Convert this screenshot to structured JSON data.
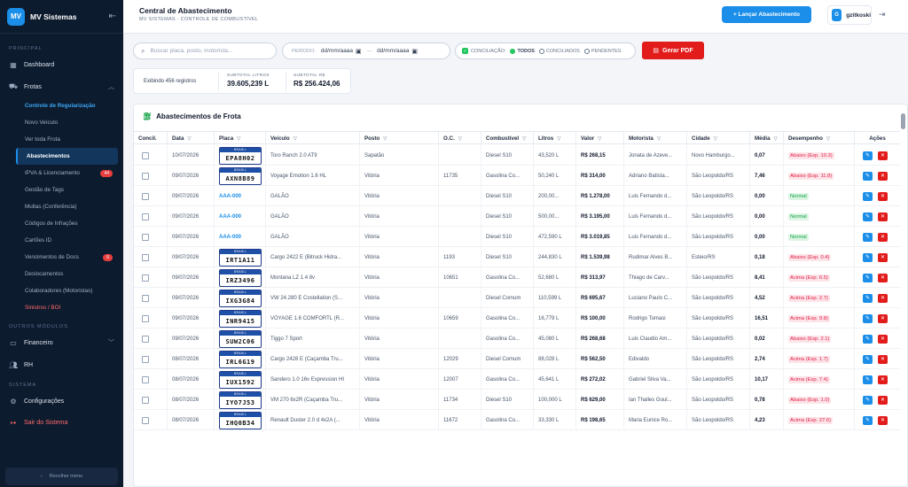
{
  "sidebar": {
    "logo": "MV",
    "brand": "MV Sistemas",
    "sec_principal": "PRINCIPAL",
    "dashboard": "Dashboard",
    "frotas": "Frotas",
    "subitems": [
      {
        "label": "Controle de Regularização",
        "badge": ""
      },
      {
        "label": "Novo Veículo",
        "badge": ""
      },
      {
        "label": "Ver toda Frota",
        "badge": ""
      },
      {
        "label": "Abastecimentos",
        "badge": ""
      },
      {
        "label": "IPVA & Licenciamento",
        "badge": "44"
      },
      {
        "label": "Gestão de Tags",
        "badge": ""
      },
      {
        "label": "Multas (Conferência)",
        "badge": ""
      },
      {
        "label": "Códigos de Infrações",
        "badge": ""
      },
      {
        "label": "Cartões ID",
        "badge": ""
      },
      {
        "label": "Vencimentos de Docs",
        "badge": "6"
      },
      {
        "label": "Deslocamentos",
        "badge": ""
      },
      {
        "label": "Colaboradores (Motoristas)",
        "badge": ""
      },
      {
        "label": "Sinistros / BOI",
        "badge": ""
      }
    ],
    "sec_outros": "OUTROS MÓDULOS",
    "financeiro": "Financeiro",
    "rh": "RH",
    "sec_sistema": "SISTEMA",
    "config": "Configurações",
    "logout": "Sair do Sistema",
    "recolher": "Recolher menu"
  },
  "topbar": {
    "title": "Central de Abastecimento",
    "subtitle": "MV SISTEMAS - CONTROLE DE COMBUSTÍVEL",
    "launch": "+ Lançar Abastecimento",
    "avatar": "G",
    "user": "gzitkoski"
  },
  "filters": {
    "search_placeholder": "Buscar placa, posto, motorista...",
    "period_label": "PERÍODO:",
    "date_start": "dd/mm/aaaa",
    "date_end": "dd/mm/aaaa",
    "date_sep": "—",
    "concil_label": "CONCILIAÇÃO:",
    "opt_todos": "TODOS",
    "opt_conciliados": "CONCILIADOS",
    "opt_pendentes": "PENDENTES",
    "pdf": "Gerar PDF"
  },
  "stats": {
    "info": "Exibindo 456 registros",
    "litros_label": "SUBTOTAL LITROS",
    "litros_value": "39.605,239 L",
    "rs_label": "SUBTOTAL R$",
    "rs_value": "R$ 256.424,06"
  },
  "table": {
    "title": "Abastecimentos de Frota",
    "headers": [
      "Concil.",
      "Data",
      "Placa",
      "Veículo",
      "Posto",
      "O.C.",
      "Combustível",
      "Litros",
      "Valor",
      "Motorista",
      "Cidade",
      "Média",
      "Desempenho",
      "Ações"
    ],
    "plate_country": "BRASIL",
    "rows": [
      {
        "data": "10/07/2026",
        "placa": "EPA8H02",
        "placa_tipo": "plate",
        "veiculo": "Toro Ranch 2.0 AT9",
        "posto": "Sapatão",
        "oc": "",
        "comb": "Diesel S10",
        "litros": "43,520 L",
        "valor": "R$ 268,15",
        "motorista": "Jonata de Azeve...",
        "cidade": "Novo Hamburgo...",
        "media": "0,07",
        "desemp": "Abaixo (Esp. 10.3)",
        "perf": "abaixo"
      },
      {
        "data": "09/07/2026",
        "placa": "AXN8B89",
        "placa_tipo": "plate",
        "veiculo": "Voyage Emotion 1.6 HL",
        "posto": "Vitória",
        "oc": "11735",
        "comb": "Gasolina Co...",
        "litros": "50,240 L",
        "valor": "R$ 314,00",
        "motorista": "Adriano Batista...",
        "cidade": "São Leopoldo/RS",
        "media": "7,46",
        "desemp": "Abaixo (Esp. 11.8)",
        "perf": "abaixo"
      },
      {
        "data": "09/07/2026",
        "placa": "AAA-000",
        "placa_tipo": "link",
        "veiculo": "GALÃO",
        "posto": "Vitória",
        "oc": "",
        "comb": "Diesel S10",
        "litros": "200,00...",
        "valor": "R$ 1.278,00",
        "motorista": "Luis Fernando d...",
        "cidade": "São Leopoldo/RS",
        "media": "0,00",
        "desemp": "Normal",
        "perf": "normal"
      },
      {
        "data": "09/07/2026",
        "placa": "AAA-000",
        "placa_tipo": "link",
        "veiculo": "GALÃO",
        "posto": "Vitória",
        "oc": "",
        "comb": "Diesel S10",
        "litros": "500,00...",
        "valor": "R$ 3.195,00",
        "motorista": "Luis Fernando d...",
        "cidade": "São Leopoldo/RS",
        "media": "0,00",
        "desemp": "Normal",
        "perf": "normal"
      },
      {
        "data": "09/07/2026",
        "placa": "AAA-000",
        "placa_tipo": "link",
        "veiculo": "GALÃO",
        "posto": "Vitória",
        "oc": "",
        "comb": "Diesel S10",
        "litros": "472,590 L",
        "valor": "R$ 3.019,85",
        "motorista": "Luis Fernando d...",
        "cidade": "São Leopoldo/RS",
        "media": "0,00",
        "desemp": "Normal",
        "perf": "normal"
      },
      {
        "data": "09/07/2026",
        "placa": "IRT1A11",
        "placa_tipo": "plate",
        "veiculo": "Cargo 2422 E (Bitruck Hidra...",
        "posto": "Vitória",
        "oc": "1193",
        "comb": "Diesel S10",
        "litros": "244,830 L",
        "valor": "R$ 1.539,98",
        "motorista": "Rudimar Alves B...",
        "cidade": "Esteio/RS",
        "media": "0,18",
        "desemp": "Abaixo (Esp. 0.4)",
        "perf": "abaixo"
      },
      {
        "data": "09/07/2026",
        "placa": "IRZ3496",
        "placa_tipo": "plate",
        "veiculo": "Montana LZ 1.4 8v",
        "posto": "Vitória",
        "oc": "10651",
        "comb": "Gasolina Co...",
        "litros": "52,680 L",
        "valor": "R$ 313,97",
        "motorista": "Thiago de Carv...",
        "cidade": "São Leopoldo/RS",
        "media": "8,41",
        "desemp": "Acima (Esp. 6.5)",
        "perf": "acima"
      },
      {
        "data": "09/07/2026",
        "placa": "IXG3G84",
        "placa_tipo": "plate",
        "veiculo": "VW 24.280 E Costellation (S...",
        "posto": "Vitória",
        "oc": "",
        "comb": "Diesel Comum",
        "litros": "110,599 L",
        "valor": "R$ 695,67",
        "motorista": "Luciano Paulo C...",
        "cidade": "São Leopoldo/RS",
        "media": "4,52",
        "desemp": "Acima (Esp. 2.7)",
        "perf": "acima"
      },
      {
        "data": "09/07/2026",
        "placa": "INR9415",
        "placa_tipo": "plate",
        "veiculo": "VOYAGE 1.6 COMFORTL (R...",
        "posto": "Vitória",
        "oc": "10659",
        "comb": "Gasolina Co...",
        "litros": "16,779 L",
        "valor": "R$ 100,00",
        "motorista": "Rodrigo Tomasi",
        "cidade": "São Leopoldo/RS",
        "media": "16,51",
        "desemp": "Acima (Esp. 9.8)",
        "perf": "acima"
      },
      {
        "data": "09/07/2026",
        "placa": "SUW2C06",
        "placa_tipo": "plate",
        "veiculo": "Tiggo 7 Sport",
        "posto": "Vitória",
        "oc": "",
        "comb": "Gasolina Co...",
        "litros": "45,080 L",
        "valor": "R$ 268,68",
        "motorista": "Luis Claudio Am...",
        "cidade": "São Leopoldo/RS",
        "media": "0,02",
        "desemp": "Abaixo (Esp. 2.1)",
        "perf": "abaixo"
      },
      {
        "data": "08/07/2026",
        "placa": "IRL6G19",
        "placa_tipo": "plate",
        "veiculo": "Cargo 2428 E (Caçamba Tru...",
        "posto": "Vitória",
        "oc": "12029",
        "comb": "Diesel Comum",
        "litros": "88,028 L",
        "valor": "R$ 562,50",
        "motorista": "Edivaldo",
        "cidade": "São Leopoldo/RS",
        "media": "2,74",
        "desemp": "Acima (Esp. 1.7)",
        "perf": "acima"
      },
      {
        "data": "08/07/2026",
        "placa": "IUX1592",
        "placa_tipo": "plate",
        "veiculo": "Sandero 1.0 16v Expression HI",
        "posto": "Vitória",
        "oc": "12007",
        "comb": "Gasolina Co...",
        "litros": "45,641 L",
        "valor": "R$ 272,02",
        "motorista": "Gabriel Silva Va...",
        "cidade": "São Leopoldo/RS",
        "media": "10,17",
        "desemp": "Acima (Esp. 7.4)",
        "perf": "acima"
      },
      {
        "data": "08/07/2026",
        "placa": "IYO7J53",
        "placa_tipo": "plate",
        "veiculo": "VM 270 6x2R (Caçamba Tru...",
        "posto": "Vitória",
        "oc": "11734",
        "comb": "Diesel S10",
        "litros": "100,000 L",
        "valor": "R$ 629,00",
        "motorista": "Ian Thalles Goul...",
        "cidade": "São Leopoldo/RS",
        "media": "0,78",
        "desemp": "Abaixo (Esp. 1.0)",
        "perf": "abaixo"
      },
      {
        "data": "08/07/2026",
        "placa": "IHQ0B34",
        "placa_tipo": "plate",
        "veiculo": "Renault Duster 2.0 d 4x2A (...",
        "posto": "Vitória",
        "oc": "11672",
        "comb": "Gasolina Co...",
        "litros": "33,330 L",
        "valor": "R$ 198,65",
        "motorista": "Maria Eunice Ro...",
        "cidade": "São Leopoldo/RS",
        "media": "4,23",
        "desemp": "Acima (Esp. 27.6)",
        "perf": "acima"
      }
    ]
  },
  "icons": {
    "menu": "dashboard-icon",
    "truck": "truck-icon",
    "money": "money-icon",
    "people": "people-icon",
    "gear": "gear-icon",
    "logout": "logout-icon"
  },
  "colors": {
    "sidebar_bg": "#0d1b2e",
    "accent": "#1a8ee8",
    "danger": "#e21b1b",
    "success": "#22c55e"
  }
}
